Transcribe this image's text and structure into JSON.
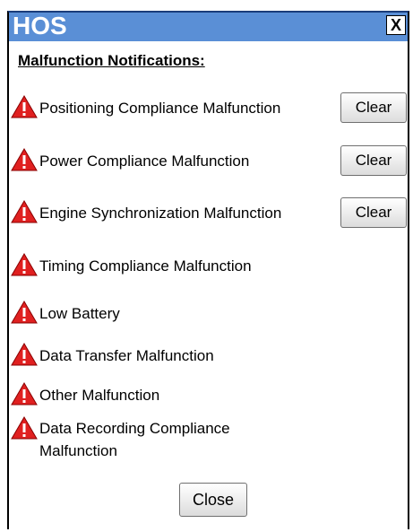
{
  "window": {
    "title": "HOS",
    "close_glyph": "X"
  },
  "heading": "Malfunction Notifications:",
  "notifications": [
    {
      "label": "Positioning Compliance Malfunction",
      "icon": "warning-icon",
      "has_clear": true
    },
    {
      "label": "Power Compliance Malfunction",
      "icon": "warning-icon",
      "has_clear": true
    },
    {
      "label": "Engine Synchronization Malfunction",
      "icon": "warning-icon",
      "has_clear": true
    },
    {
      "label": "Timing Compliance Malfunction",
      "icon": "warning-icon",
      "has_clear": false
    },
    {
      "label": "Low Battery",
      "icon": "warning-icon",
      "has_clear": false
    },
    {
      "label": "Data Transfer Malfunction",
      "icon": "warning-icon",
      "has_clear": false
    },
    {
      "label": "Other Malfunction",
      "icon": "warning-icon",
      "has_clear": false
    },
    {
      "label": "Data Recording Compliance Malfunction",
      "icon": "warning-icon",
      "has_clear": false
    }
  ],
  "clear_label": "Clear",
  "close_label": "Close",
  "colors": {
    "titlebar": "#5a8fd6",
    "warning": "#e02020"
  }
}
